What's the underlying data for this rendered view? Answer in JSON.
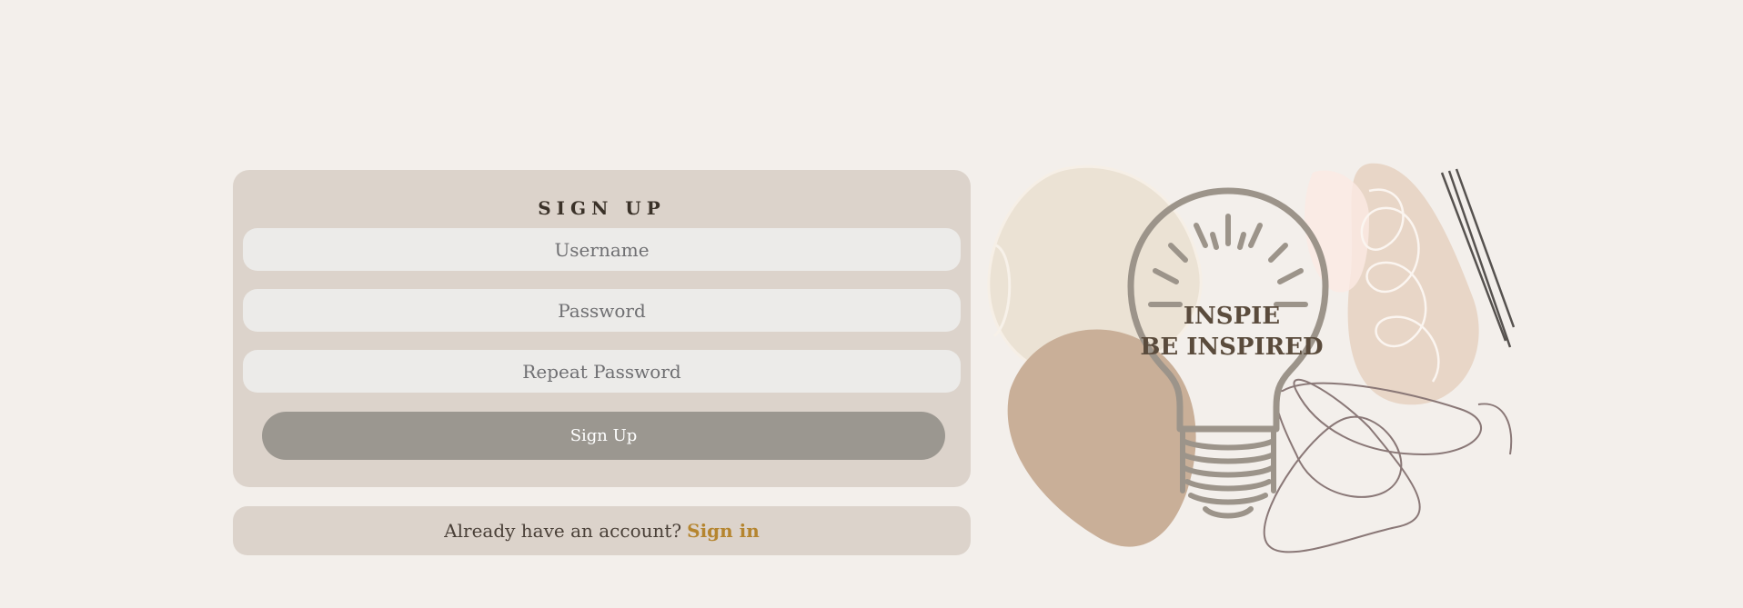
{
  "signup": {
    "title": "SIGN UP",
    "username_placeholder": "Username",
    "password_placeholder": "Password",
    "repeat_password_placeholder": "Repeat Password",
    "submit_label": "Sign Up"
  },
  "signin": {
    "prompt": "Already have an account?",
    "link_label": "Sign in"
  },
  "illustration": {
    "line1": "INSPIE",
    "line2": "BE INSPIRED"
  },
  "colors": {
    "background": "#f3efeb",
    "card": "#dcd3cb",
    "input": "#ecebe9",
    "button": "#9b9790",
    "link": "#b5852f",
    "bulb_stroke": "#9c948a",
    "bulb_text": "#5a4b3c"
  }
}
